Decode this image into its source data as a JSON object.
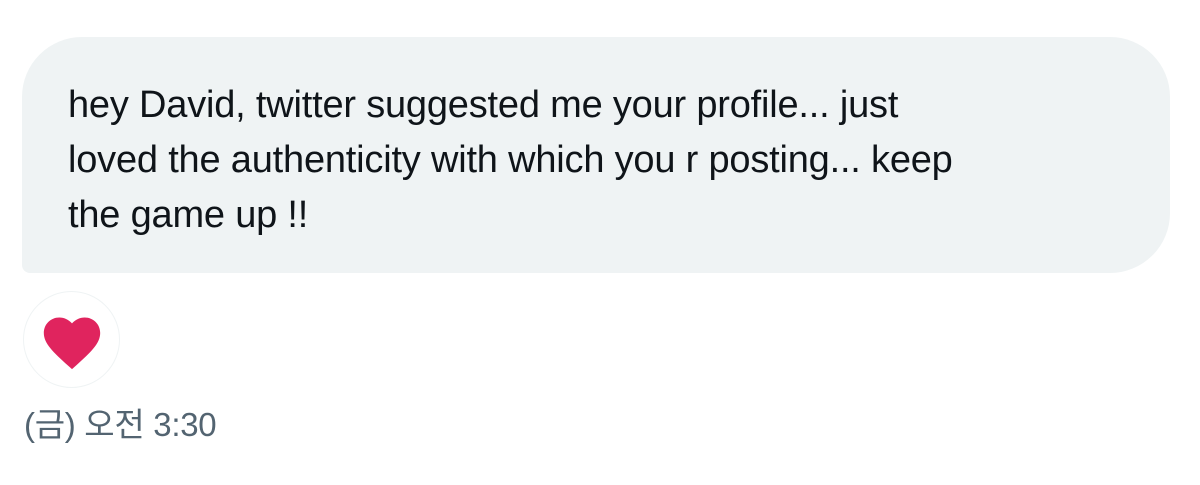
{
  "message": {
    "text": "hey David, twitter suggested me your profile... just\nloved the authenticity with which you r posting... keep\nthe game up !!",
    "timestamp": "(금) 오전 3:30"
  },
  "reaction": {
    "icon": "heart-icon",
    "color": "#e0245e"
  },
  "colors": {
    "bubble_background": "#eff3f4",
    "text": "#0f1419",
    "secondary_text": "#536471"
  }
}
